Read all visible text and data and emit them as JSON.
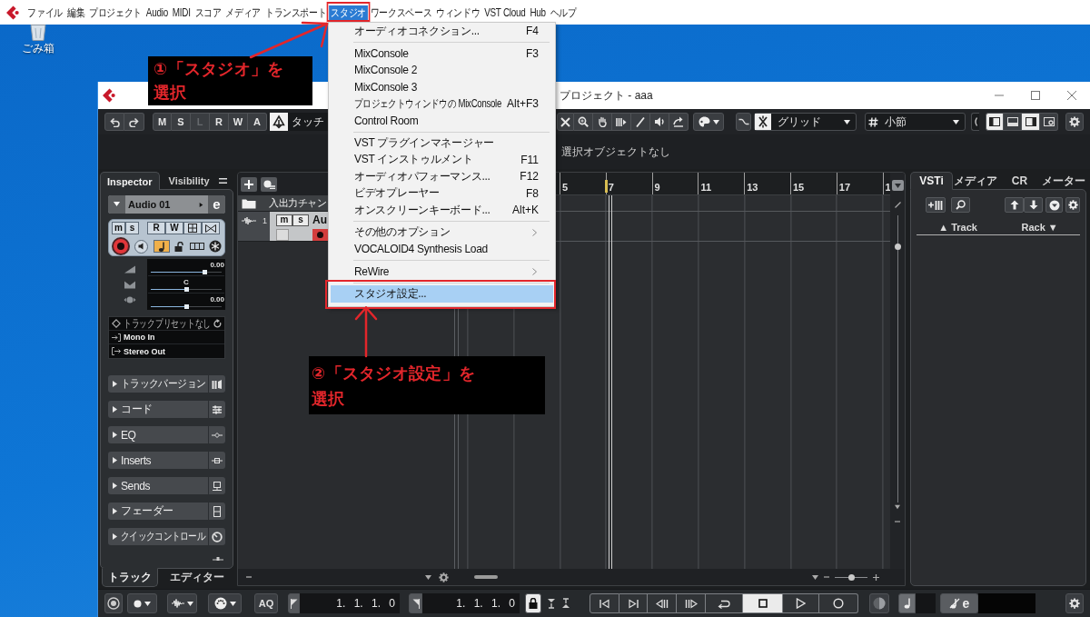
{
  "menubar": {
    "items": [
      {
        "label": "ファイル",
        "selected": false
      },
      {
        "label": "編集",
        "selected": false
      },
      {
        "label": "プロジェクト",
        "selected": false
      },
      {
        "label": "Audio",
        "selected": false
      },
      {
        "label": "MIDI",
        "selected": false
      },
      {
        "label": "スコア",
        "selected": false
      },
      {
        "label": "メディア",
        "selected": false
      },
      {
        "label": "トランスポート",
        "selected": false
      },
      {
        "label": "スタジオ",
        "selected": true
      },
      {
        "label": "ワークスペース",
        "selected": false
      },
      {
        "label": "ウィンドウ",
        "selected": false
      },
      {
        "label": "VST Cloud",
        "selected": false
      },
      {
        "label": "Hub",
        "selected": false
      },
      {
        "label": "ヘルプ",
        "selected": false
      }
    ]
  },
  "desktop": {
    "icons": [
      {
        "label": "ごみ箱"
      }
    ]
  },
  "window": {
    "title": "プロジェクト - aaa"
  },
  "toolbar": {
    "automation_buttons": [
      {
        "label": "M",
        "disabled": false
      },
      {
        "label": "S",
        "disabled": false
      },
      {
        "label": "L",
        "disabled": true
      },
      {
        "label": "R",
        "disabled": false
      },
      {
        "label": "W",
        "disabled": false
      },
      {
        "label": "A",
        "disabled": false
      }
    ],
    "automation_mode": "タッチ",
    "snap_type": "グリッド",
    "grid_type": "小節",
    "view_buttons": [
      {
        "selected": true
      },
      {
        "selected": false
      },
      {
        "selected": true
      },
      {
        "selected": false
      }
    ]
  },
  "info_line": {
    "text": "選択オブジェクトなし"
  },
  "inspector": {
    "tabs": [
      {
        "label": "Inspector",
        "selected": true
      },
      {
        "label": "Visibility",
        "selected": false
      }
    ],
    "track_name": "Audio 01",
    "edit_label": "e",
    "mute_label": "m",
    "solo_label": "s",
    "read_label": "R",
    "write_label": "W",
    "musical_mode": true,
    "volume": {
      "reading": "0.00",
      "level": 0.76
    },
    "pan": {
      "reading": "C",
      "level": 0.5
    },
    "delay": {
      "reading": "0.00",
      "level": 0.5
    },
    "preset": "トラックプリセットなし",
    "input": "Mono In",
    "output": "Stereo Out",
    "sections": [
      {
        "label": "トラックバージョン",
        "expanded": false
      },
      {
        "label": "コード",
        "expanded": false
      },
      {
        "label": "EQ",
        "expanded": false
      },
      {
        "label": "Inserts",
        "expanded": false
      },
      {
        "label": "Sends",
        "expanded": false
      },
      {
        "label": "フェーダー",
        "expanded": false
      },
      {
        "label": "クイックコントロール",
        "expanded": false
      }
    ],
    "bottom_tabs": [
      {
        "label": "トラック",
        "selected": true
      },
      {
        "label": "エディター",
        "selected": false
      }
    ]
  },
  "track_list": {
    "folder": {
      "name": "入出力チャン"
    },
    "tracks": [
      {
        "number": "1",
        "mute_label": "m",
        "solo_label": "s",
        "name": "Au"
      }
    ]
  },
  "event_display": {
    "ruler": [
      "5",
      "7",
      "9",
      "11",
      "13",
      "15",
      "17",
      "1"
    ],
    "vertical_zoom": {
      "level": 0.89
    },
    "horizontal_zoom": {
      "level": 0.5
    }
  },
  "right_zone": {
    "tabs": [
      {
        "label": "VSTi",
        "selected": true
      },
      {
        "label": "メディア",
        "selected": false
      },
      {
        "label": "CR",
        "selected": false
      },
      {
        "label": "メーター",
        "selected": false
      }
    ],
    "sort": [
      "▲ Track",
      "Rack ▼"
    ]
  },
  "transport": {
    "quantize_label": "AQ",
    "left_locator": "1. 1. 1. 0",
    "right_locator": "1. 1. 1. 0",
    "locked": true,
    "buttons": [
      {
        "selected": false
      },
      {
        "selected": false
      },
      {
        "selected": false
      },
      {
        "selected": false
      },
      {
        "selected": false
      },
      {
        "selected": true
      },
      {
        "selected": false
      },
      {
        "selected": false
      }
    ],
    "edit_label": "e"
  },
  "studio_menu": {
    "items": [
      {
        "kind": "item",
        "label": "オーディオコネクション...",
        "shortcut": "F4",
        "selected": false
      },
      {
        "kind": "separator"
      },
      {
        "kind": "item",
        "label": "MixConsole",
        "shortcut": "F3",
        "selected": false
      },
      {
        "kind": "item",
        "label": "MixConsole 2",
        "selected": false
      },
      {
        "kind": "item",
        "label": "MixConsole 3",
        "selected": false
      },
      {
        "kind": "item",
        "label": "プロジェクトウィンドウの MixConsole",
        "shortcut": "Alt+F3",
        "selected": false
      },
      {
        "kind": "item",
        "label": "Control Room",
        "selected": false
      },
      {
        "kind": "separator"
      },
      {
        "kind": "item",
        "label": "VST プラグインマネージャー",
        "selected": false
      },
      {
        "kind": "item",
        "label": "VST インストゥルメント",
        "shortcut": "F11",
        "selected": false
      },
      {
        "kind": "item",
        "label": "オーディオパフォーマンス...",
        "shortcut": "F12",
        "selected": false
      },
      {
        "kind": "item",
        "label": "ビデオプレーヤー",
        "shortcut": "F8",
        "selected": false
      },
      {
        "kind": "item",
        "label": "オンスクリーンキーボード...",
        "shortcut": "Alt+K",
        "selected": false
      },
      {
        "kind": "separator"
      },
      {
        "kind": "submenu",
        "label": "その他のオプション",
        "selected": false
      },
      {
        "kind": "item",
        "label": "VOCALOID4 Synthesis Load",
        "selected": false
      },
      {
        "kind": "separator"
      },
      {
        "kind": "submenu",
        "label": "ReWire",
        "selected": false
      },
      {
        "kind": "separator"
      },
      {
        "kind": "item",
        "label": "スタジオ設定...",
        "selected": true
      }
    ]
  },
  "annotations": [
    {
      "lines": [
        "①「スタジオ」を",
        "選択"
      ]
    },
    {
      "lines": [
        "②「スタジオ設定」を",
        "選択"
      ]
    }
  ]
}
